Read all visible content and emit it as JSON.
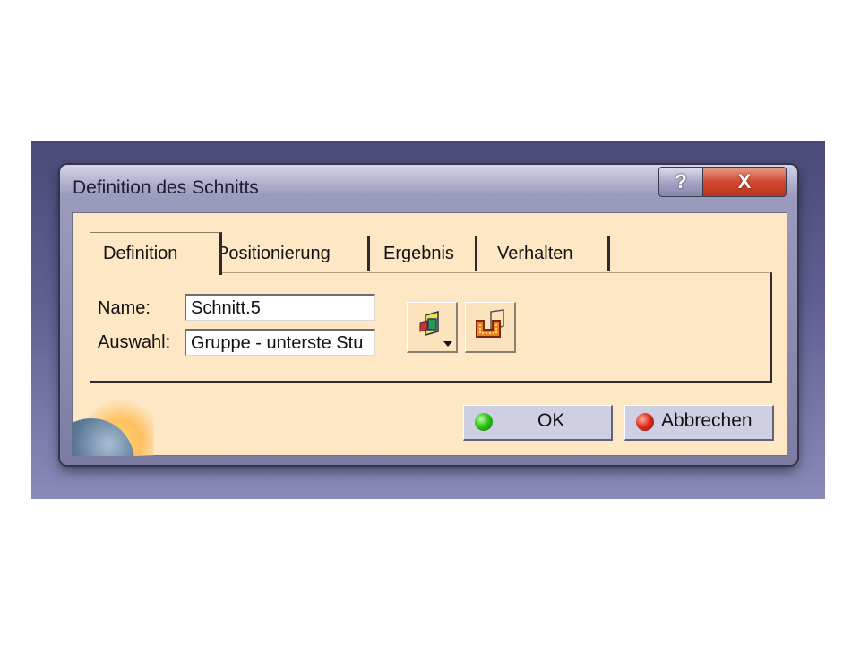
{
  "dialog": {
    "title": "Definition des Schnitts",
    "help_button": "?",
    "close_button": "X"
  },
  "tabs": [
    {
      "label": "Definition",
      "active": true
    },
    {
      "label": "Positionierung",
      "active": false
    },
    {
      "label": "Ergebnis",
      "active": false
    },
    {
      "label": "Verhalten",
      "active": false
    }
  ],
  "form": {
    "name_label": "Name:",
    "name_value": "Schnitt.5",
    "selection_label": "Auswahl:",
    "selection_value": "Gruppe - unterste Stu"
  },
  "tools": [
    {
      "icon": "section-plane-icon",
      "has_dropdown": true
    },
    {
      "icon": "section-profile-icon",
      "has_dropdown": false
    }
  ],
  "buttons": {
    "ok": "OK",
    "cancel": "Abbrechen"
  },
  "colors": {
    "client_background": "#fde7c4",
    "title_bar": "#7c7ca3",
    "close_red": "#cf4a2f",
    "button_face": "#cfcfe3"
  }
}
